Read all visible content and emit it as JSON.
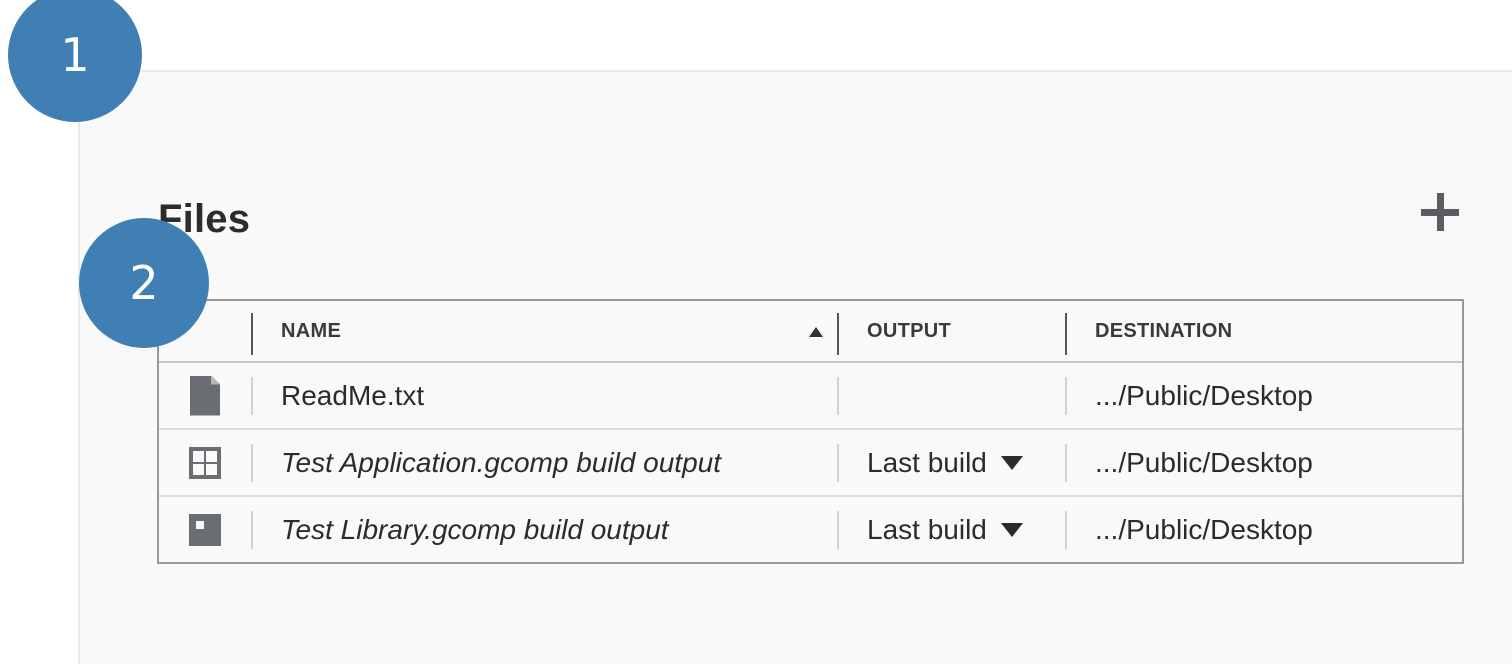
{
  "section": {
    "title": "Files",
    "add_icon": "plus-icon"
  },
  "table": {
    "columns": [
      "NAME",
      "OUTPUT",
      "DESTINATION"
    ],
    "sort": {
      "column": "NAME",
      "direction": "ascending"
    },
    "rows": [
      {
        "icon": "text-file-icon",
        "name": "ReadMe.txt",
        "italic": false,
        "output": "",
        "destination": ".../Public/Desktop"
      },
      {
        "icon": "application-grid-icon",
        "name": "Test Application.gcomp build output",
        "italic": true,
        "output": "Last build",
        "destination": ".../Public/Desktop"
      },
      {
        "icon": "library-icon",
        "name": "Test Library.gcomp build output",
        "italic": true,
        "output": "Last build",
        "destination": ".../Public/Desktop"
      }
    ]
  },
  "callouts": [
    "1",
    "2"
  ],
  "colors": {
    "callout": "#3f7fb3",
    "icon": "#6a6d72",
    "panel": "#f9f9f9",
    "border": "#9a9a9a"
  }
}
